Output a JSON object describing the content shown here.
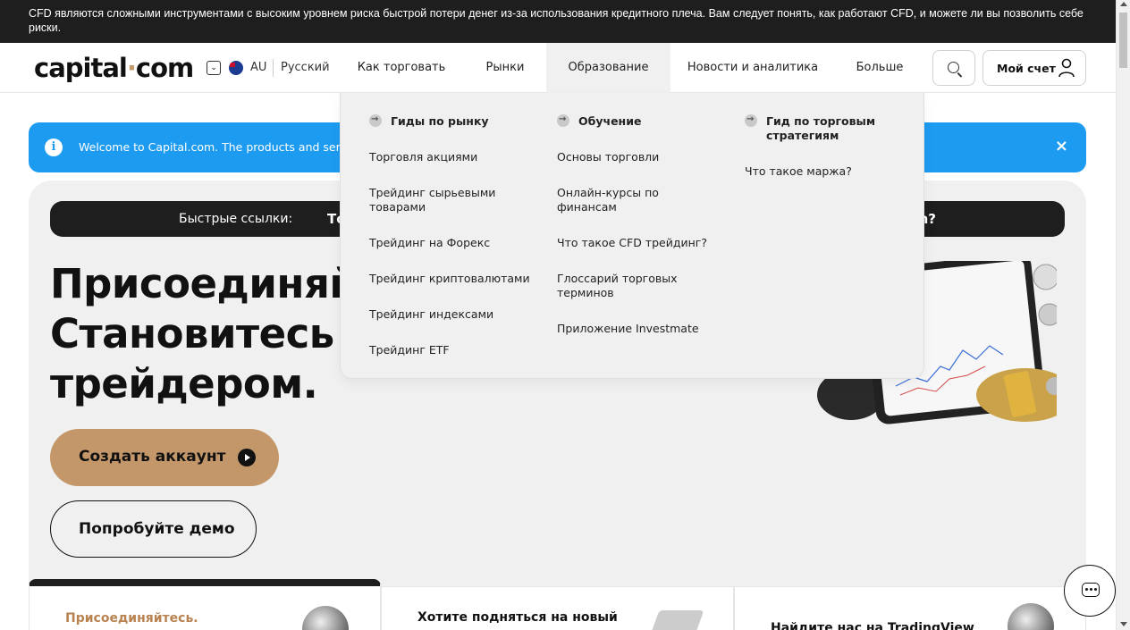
{
  "risk_warning": "CFD являются сложными инструментами с высоким уровнем риска быстрой потери денег из-за использования кредитного плеча. Вам следует понять, как работают CFD, и можете ли вы позволить себе риски.",
  "header": {
    "logo_left": "capital",
    "logo_dot": "·",
    "logo_right": "com",
    "region": "AU",
    "language": "Русский",
    "nav": [
      "Как торговать",
      "Рынки",
      "Образование",
      "Новости и аналитика",
      "Больше"
    ],
    "active_nav": "Образование",
    "account_label": "Мой счет"
  },
  "welcome_banner": {
    "text": "Welcome to Capital.com. The products and servi",
    "close": "×"
  },
  "quick_links": {
    "label": "Быстрые ссылки:",
    "item_visible_start": "То",
    "item_visible_end": "n?"
  },
  "hero": {
    "headline_lines": [
      "Присоединяйт",
      "Становитесь",
      "трейдером."
    ],
    "create_account": "Создать аккаунт",
    "try_demo": "Попробуйте демо"
  },
  "dropdown": {
    "columns": [
      {
        "title": "Гиды по рынку",
        "links": [
          "Торговля акциями",
          "Трейдинг сырьевыми товарами",
          "Трейдинг на Форекс",
          "Трейдинг криптовалютами",
          "Трейдинг индексами",
          "Трейдинг ETF"
        ]
      },
      {
        "title": "Обучение",
        "links": [
          "Основы торговли",
          "Онлайн-курсы по финансам",
          "Что такое CFD трейдинг?",
          "Глоссарий торговых терминов",
          "Приложение Investmate"
        ]
      },
      {
        "title": "Гид по торговым стратегиям",
        "links": [
          "Что такое маржа?"
        ]
      }
    ]
  },
  "cards": [
    {
      "title": "Присоединяйтесь."
    },
    {
      "title": "Хотите подняться на новый"
    },
    {
      "title": "Найдите нас на TradingView"
    }
  ],
  "colors": {
    "accent_gold": "#c4976a",
    "banner_blue": "#1d9bf0",
    "dark": "#1e1e1e",
    "panel_grey": "#f0f0f1"
  }
}
